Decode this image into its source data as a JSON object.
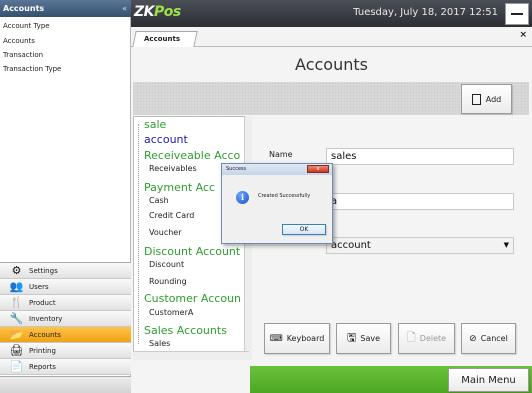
{
  "sidebar": {
    "header": "Accounts",
    "collapse_glyph": "«",
    "sub_items": [
      {
        "label": "Account Type"
      },
      {
        "label": "Accounts"
      },
      {
        "label": "Transaction"
      },
      {
        "label": "Transaction Type"
      }
    ],
    "modules": [
      {
        "label": "Settings",
        "icon": "gear-icon"
      },
      {
        "label": "Users",
        "icon": "users-icon"
      },
      {
        "label": "Product",
        "icon": "cutlery-icon"
      },
      {
        "label": "Inventory",
        "icon": "wrench-icon"
      },
      {
        "label": "Accounts",
        "icon": "folder-icon",
        "active": true
      },
      {
        "label": "Printing",
        "icon": "printer-icon"
      },
      {
        "label": "Reports",
        "icon": "report-icon"
      }
    ]
  },
  "topbar": {
    "logo_main": "ZK",
    "logo_accent": "Pos",
    "datetime": "Tuesday, July 18, 2017 12:51"
  },
  "tab": {
    "label": "Accounts",
    "close_glyph": "×"
  },
  "page": {
    "title": "Accounts",
    "add_label": "Add"
  },
  "tree": {
    "nodes": [
      {
        "label": "sale",
        "style": "g"
      },
      {
        "label": "account",
        "style": "b"
      },
      {
        "label": "Receiveable Acco",
        "style": "g"
      },
      {
        "label": "Receivables",
        "style": "s"
      },
      {
        "label": "Payment Acc",
        "style": "g"
      },
      {
        "label": "Cash",
        "style": "s"
      },
      {
        "label": "Credit Card",
        "style": "s"
      },
      {
        "label": "Voucher",
        "style": "s"
      },
      {
        "label": "Discount Account",
        "style": "g"
      },
      {
        "label": "Discount",
        "style": "s"
      },
      {
        "label": "Rounding",
        "style": "s"
      },
      {
        "label": "Customer Accoun",
        "style": "g"
      },
      {
        "label": "CustomerA",
        "style": "s"
      },
      {
        "label": "Sales Accounts",
        "style": "g"
      },
      {
        "label": "Sales",
        "style": "s"
      }
    ]
  },
  "form": {
    "name_label": "Name",
    "name_value": "sales",
    "field2_value": "a",
    "select_value": "account"
  },
  "actions": {
    "keyboard": "Keyboard",
    "save": "Save",
    "delete": "Delete",
    "cancel": "Cancel",
    "main_menu": "Main Menu"
  },
  "dialog": {
    "title": "Success",
    "close_glyph": "x",
    "icon_glyph": "i",
    "message": "Created Successfully",
    "ok": "OK"
  },
  "colors": {
    "active_module": "#f0a212",
    "green_bar": "#5ab02d",
    "tree_green": "#2f9e2f",
    "tree_blue": "#1c1cae"
  }
}
